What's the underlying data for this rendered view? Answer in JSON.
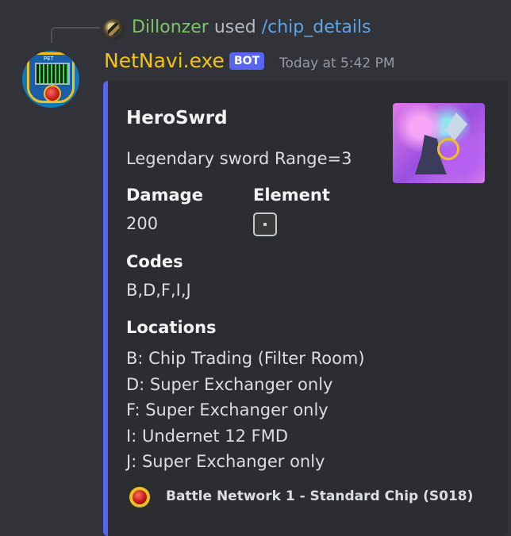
{
  "reply": {
    "username": "Dillonzer",
    "used_text": "used",
    "command": "/chip_details"
  },
  "message": {
    "author": "NetNavi.exe",
    "bot_tag": "BOT",
    "timestamp": "Today at 5:42 PM",
    "avatar_label": "PET"
  },
  "embed": {
    "accent_color": "#5865f2",
    "title": "HeroSwrd",
    "description": "Legendary sword Range=3",
    "fields": {
      "damage": {
        "name": "Damage",
        "value": "200"
      },
      "element": {
        "name": "Element",
        "icon": "null-element-icon"
      },
      "codes": {
        "name": "Codes",
        "value": "B,D,F,I,J"
      },
      "locations": {
        "name": "Locations",
        "items": [
          "B: Chip Trading (Filter Room)",
          "D: Super Exchanger only",
          "F: Super Exchanger only",
          "I: Undernet 12 FMD",
          "J: Super Exchanger only"
        ]
      }
    },
    "footer": "Battle Network 1 - Standard Chip (S018)"
  },
  "colors": {
    "background": "#313338",
    "embed_background": "#2b2d31",
    "username": "#f1c40f",
    "reply_username": "#7cc46a",
    "command": "#5fa4e6"
  }
}
